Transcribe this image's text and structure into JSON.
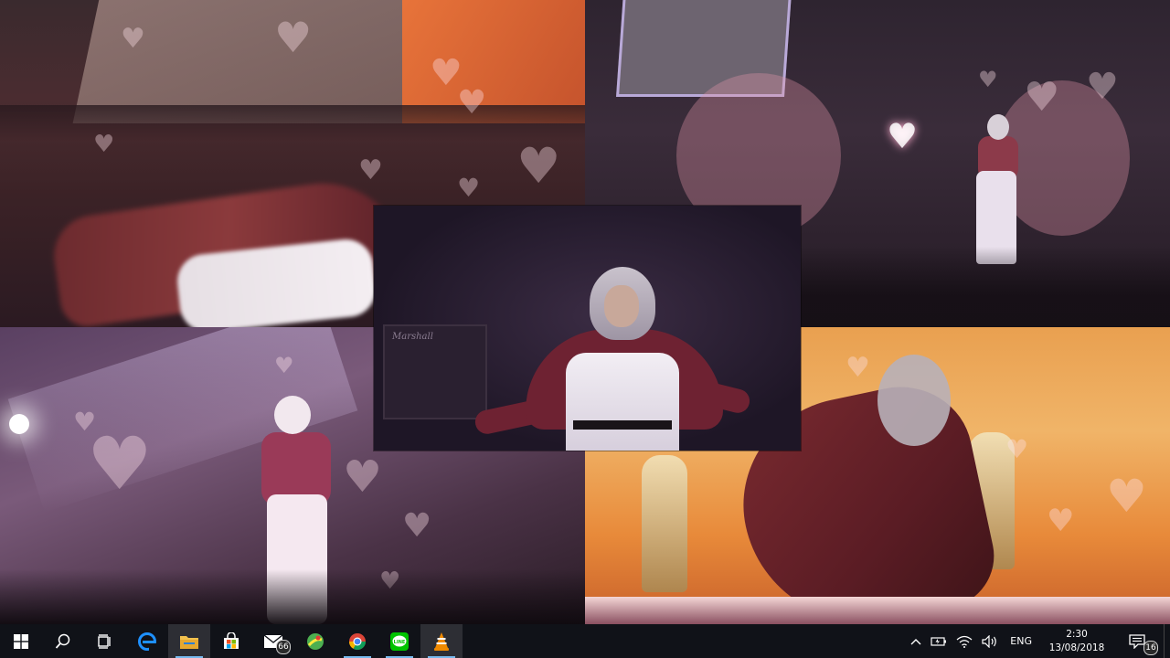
{
  "panels": {
    "center": {
      "amp_brand": "Marshall"
    }
  },
  "taskbar": {
    "apps": [
      {
        "name": "start",
        "icon": "windows-logo-icon"
      },
      {
        "name": "search",
        "icon": "search-icon"
      },
      {
        "name": "task-view",
        "icon": "task-view-icon"
      },
      {
        "name": "edge",
        "icon": "edge-icon"
      },
      {
        "name": "file-explorer",
        "icon": "folder-icon"
      },
      {
        "name": "store",
        "icon": "store-icon"
      },
      {
        "name": "mail",
        "icon": "mail-icon",
        "badge": "66"
      },
      {
        "name": "maps",
        "icon": "maps-icon"
      },
      {
        "name": "chrome",
        "icon": "chrome-icon"
      },
      {
        "name": "line",
        "icon": "line-icon"
      },
      {
        "name": "vlc",
        "icon": "vlc-icon"
      }
    ],
    "tray": {
      "language": "ENG",
      "time": "2:30",
      "date": "13/08/2018",
      "notification_count": "16"
    }
  },
  "colors": {
    "taskbar_bg": "#101218",
    "accent": "#76b9ed"
  }
}
